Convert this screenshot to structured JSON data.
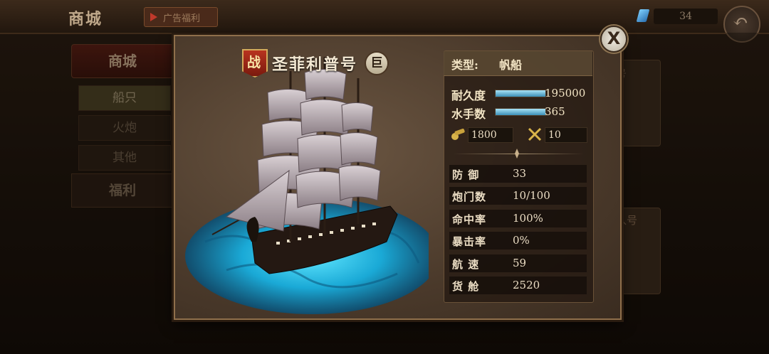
{
  "topbar": {
    "title": "商城",
    "ad_label": "广告福利",
    "gem_count": "34"
  },
  "sidemenu": {
    "header": "商城",
    "items": [
      {
        "label": "船只"
      },
      {
        "label": "火炮"
      },
      {
        "label": "其他"
      }
    ],
    "welfare": "福利"
  },
  "background_cards": {
    "card1_text": "号",
    "card2_text": "入号"
  },
  "dialog": {
    "badge": "战",
    "ship_name": "圣菲利普号",
    "size_badge": "巨",
    "type_label": "类型:",
    "type_value": "帆船",
    "durability": {
      "label": "耐久度",
      "value": "195000",
      "fill": 1.0
    },
    "sailors": {
      "label": "水手数",
      "value": "365",
      "fill": 1.0
    },
    "cannon_value": "1800",
    "attack_value": "10",
    "stats": [
      {
        "name": "防 御",
        "value": "33"
      },
      {
        "name": "炮门数",
        "value": "10/100"
      },
      {
        "name": "命中率",
        "value": "100%"
      },
      {
        "name": "暴击率",
        "value": "0%"
      },
      {
        "name": "航 速",
        "value": "59"
      },
      {
        "name": "货 舱",
        "value": "2520"
      }
    ],
    "close_label": "X"
  },
  "colors": {
    "accent": "#8f6f4b",
    "bar": "#3b8fb6",
    "badge_red": "#b8331f"
  },
  "icons": [
    "play-icon",
    "gem-icon",
    "back-arrow-icon",
    "close-icon",
    "cannon-icon",
    "crossed-swords-icon",
    "ornament-icon"
  ]
}
